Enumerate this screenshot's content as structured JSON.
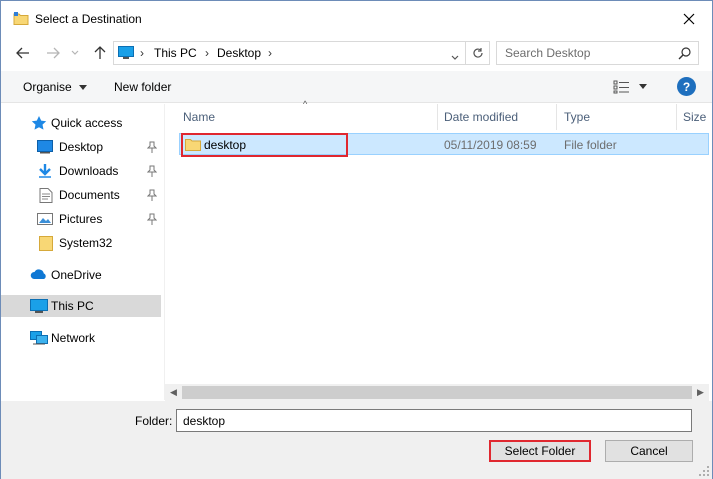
{
  "window": {
    "title": "Select a Destination"
  },
  "address": {
    "crumbs": [
      "This PC",
      "Desktop"
    ],
    "search_placeholder": "Search Desktop"
  },
  "toolbar": {
    "organise_label": "Organise",
    "new_folder_label": "New folder",
    "help_label": "?"
  },
  "nav": {
    "quick_access": "Quick access",
    "items": [
      {
        "label": "Desktop",
        "icon": "desktop-icon",
        "pinned": true
      },
      {
        "label": "Downloads",
        "icon": "downloads-icon",
        "pinned": true
      },
      {
        "label": "Documents",
        "icon": "documents-icon",
        "pinned": true
      },
      {
        "label": "Pictures",
        "icon": "pictures-icon",
        "pinned": true
      },
      {
        "label": "System32",
        "icon": "folder-icon",
        "pinned": false
      }
    ],
    "onedrive": "OneDrive",
    "this_pc": "This PC",
    "network": "Network"
  },
  "filelist": {
    "columns": [
      "Name",
      "Date modified",
      "Type",
      "Size"
    ],
    "rows": [
      {
        "name": "desktop",
        "date": "05/11/2019 08:59",
        "type": "File folder",
        "size": ""
      }
    ]
  },
  "footer": {
    "folder_label": "Folder:",
    "folder_value": "desktop",
    "select_label": "Select Folder",
    "cancel_label": "Cancel"
  },
  "colors": {
    "accent": "#1e6fbe",
    "selection": "#cce8ff",
    "highlight": "#e0272f"
  }
}
